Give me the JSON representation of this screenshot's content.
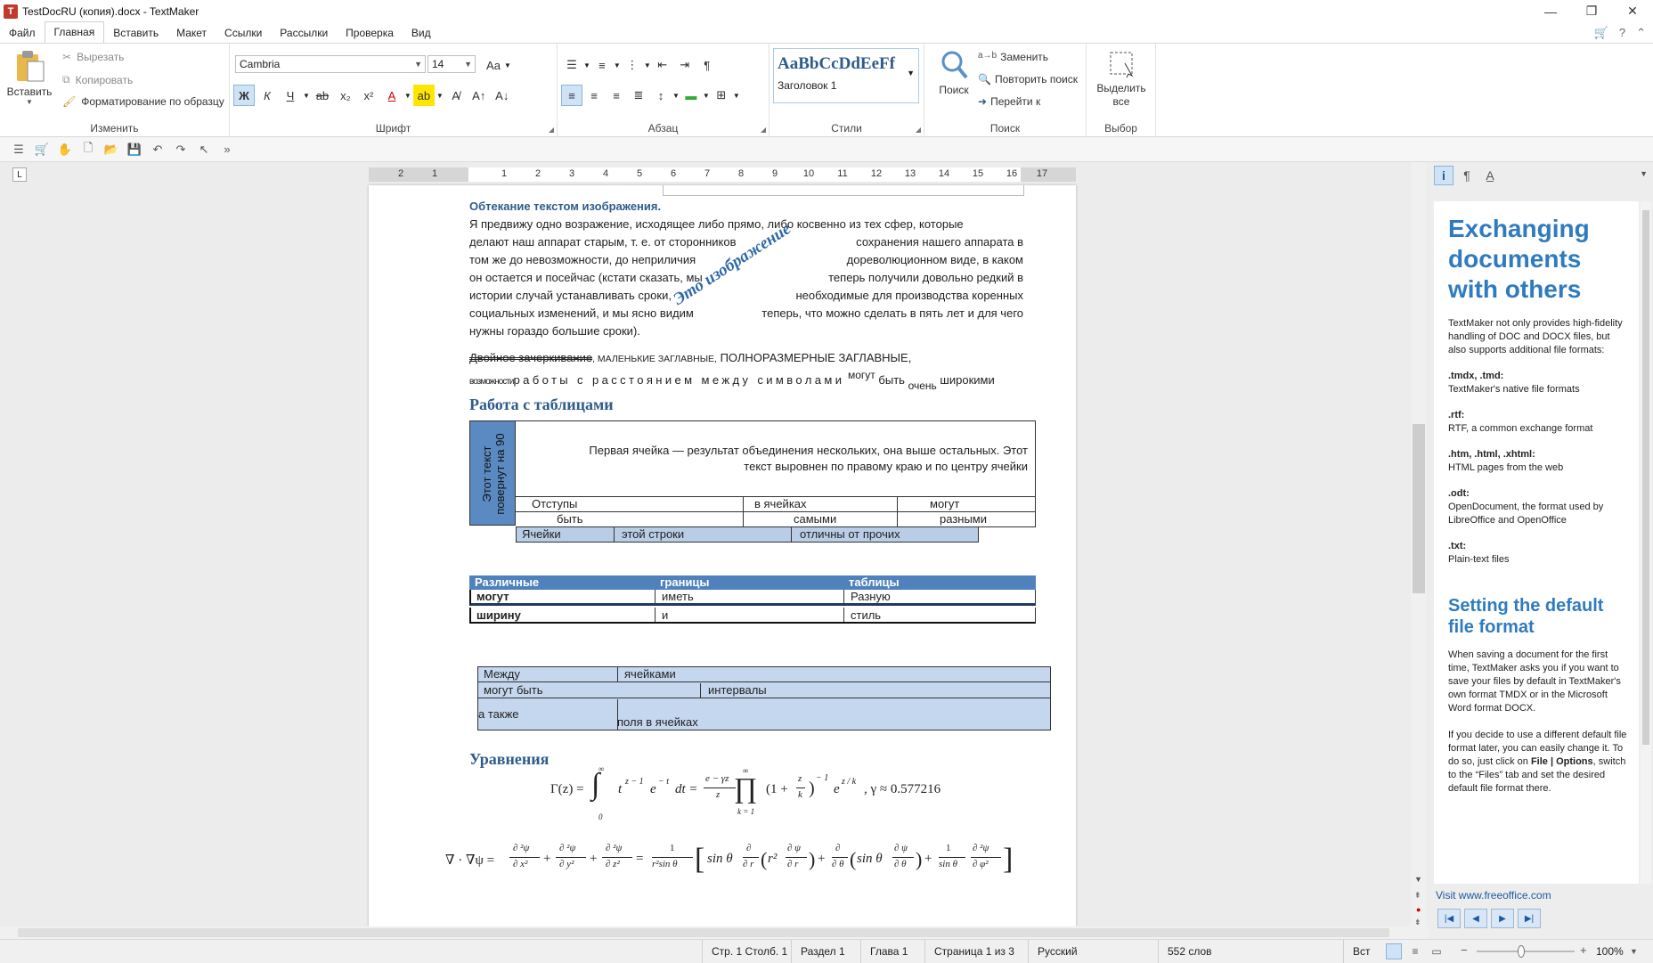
{
  "window": {
    "title": "TestDocRU (копия).docx - TextMaker"
  },
  "menu": [
    "Файл",
    "Главная",
    "Вставить",
    "Макет",
    "Ссылки",
    "Рассылки",
    "Проверка",
    "Вид"
  ],
  "ribbon": {
    "clipboard": {
      "paste": "Вставить",
      "cut": "Вырезать",
      "copy": "Копировать",
      "format_painter": "Форматирование по образцу",
      "label": "Изменить"
    },
    "font": {
      "name": "Cambria",
      "size": "14",
      "label": "Шрифт",
      "bold": "Ж",
      "italic": "К",
      "underline": "Ч"
    },
    "paragraph": {
      "label": "Абзац"
    },
    "styles": {
      "preview": "AaBbCcDdEeFf",
      "style_name": "Заголовок 1",
      "label": "Стили"
    },
    "search": {
      "find": "Поиск",
      "replace": "Заменить",
      "repeat": "Повторить поиск",
      "goto": "Перейти к",
      "label": "Поиск"
    },
    "select": {
      "select_all": "Выделить все",
      "label": "Выбор"
    }
  },
  "ruler": {
    "numbers": [
      "2",
      "1",
      "1",
      "2",
      "3",
      "4",
      "5",
      "6",
      "7",
      "8",
      "9",
      "10",
      "11",
      "12",
      "13",
      "14",
      "15",
      "16",
      "17"
    ]
  },
  "document": {
    "wrap_heading": "Обтекание текстом изображения.",
    "wrap_lines": [
      "Я предвижу одно возражение, исходящее либо прямо, либо косвенно из тех сфер, которые",
      "делают наш аппарат старым, т. е. от сторонников",
      "сохранения нашего аппарата в",
      "том же до невозможности, до неприличия",
      "дореволюционном виде, в каком",
      "он остается и посейчас (кстати сказать, мы",
      "теперь получили довольно редкий в",
      "истории случай устанавливать сроки,",
      "необходимые для производства коренных",
      "социальных изменений, и мы ясно видим",
      "теперь, что можно сделать в пять лет и для чего",
      "нужны гораздо большие сроки)."
    ],
    "rotated_image_text": "Это изображение",
    "effects": {
      "double_strike": "Двойное зачеркивание",
      "small_caps": ", МАЛЕНЬКИЕ ЗАГЛАВНЫЕ,",
      "all_caps": " ПОЛНОРАЗМЕРНЫЕ ЗАГЛАВНЫЕ,",
      "condensed": "возможности",
      "spaced": "работы с расстоянием между символами",
      "superscript": "могут",
      "normal": "быть",
      "subscript": "очень",
      "wide": "широкими"
    },
    "tables_heading": "Работа с таблицами",
    "table1": {
      "rotated": "Этот текст повернут на 90",
      "merged": "Первая ячейка — результат  объединения нескольких, она выше остальных. Этот текст выровнен по правому краю и по центру ячейки",
      "row1": [
        "Отступы",
        "в ячейках",
        "могут"
      ],
      "row2": [
        "быть",
        "самыми",
        "разными"
      ],
      "row3": [
        "Ячейки",
        "этой строки",
        "отличны от прочих"
      ]
    },
    "table2": {
      "header": [
        "Различные",
        "границы",
        "таблицы"
      ],
      "row1": [
        "могут",
        "иметь",
        "Разную"
      ],
      "row2": [
        "ширину",
        "и",
        "стиль"
      ]
    },
    "table3": {
      "row1": [
        "Между",
        "ячейками"
      ],
      "row2": [
        "могут быть",
        "интервалы"
      ],
      "row3": [
        "а также",
        "поля в ячейках"
      ]
    },
    "equations_heading": "Уравнения",
    "eq1": {
      "lhs": "Γ(z) =",
      "integrand": "t",
      "exp1": "z − 1",
      "mid": "e",
      "exp2": "− t",
      "dt": "dt =",
      "frac_num": "e − γz",
      "frac_den": "z",
      "upper": "∞",
      "lower": "0",
      "prod_upper": "∞",
      "prod_lower": "k = 1",
      "prod_body": "(1 +",
      "z": "z",
      "k": "k",
      "prod_exp": "− 1",
      "ez": "e",
      "ez_exp": "z / k",
      "gamma": ", γ ≈ 0.577216"
    },
    "eq2": {
      "lhs": "∇ · ∇ψ =",
      "t1_num": "∂ ²ψ",
      "t1_den": "∂ x²",
      "t2_num": "∂ ²ψ",
      "t2_den": "∂ y²",
      "t3_num": "∂ ²ψ",
      "t3_den": "∂ z²",
      "eq": "=",
      "c_num": "1",
      "c_den": "r²sin θ",
      "b1": "sin θ",
      "b1_num": "∂",
      "b1_den": "∂ r",
      "b2": "r² ",
      "b2_num": "∂ ψ",
      "b2_den": "∂ r",
      "b3_num": "∂",
      "b3_den": "∂ θ",
      "b4": "sin θ",
      "b4_num": "∂ ψ",
      "b4_den": "∂ θ",
      "c2_num": "1",
      "c2_den": "sin θ",
      "b5_num": "∂ ²ψ",
      "b5_den": "∂ φ²"
    }
  },
  "sidepanel": {
    "h1": "Exchanging documents with others",
    "intro": "TextMaker not only provides high-fidelity handling of DOC and DOCX files, but also supports additional file formats:",
    "formats": [
      {
        "ext": ".tmdx, .tmd:",
        "desc": "TextMaker's native file formats"
      },
      {
        "ext": ".rtf:",
        "desc": "RTF, a common exchange format"
      },
      {
        "ext": ".htm, .html, .xhtml:",
        "desc": "HTML pages from the web"
      },
      {
        "ext": ".odt:",
        "desc": "OpenDocument, the format used by LibreOffice and OpenOffice"
      },
      {
        "ext": ".txt:",
        "desc": "Plain-text files"
      }
    ],
    "h2": "Setting the default file format",
    "p1": "When saving a document for the first time, TextMaker asks you if you want to save your files by default in TextMaker's own format TMDX or in the Microsoft Word format DOCX.",
    "p2_a": "If you decide to use a different default file format later, you can easily change it. To do so, just click on ",
    "p2_b": "File | Options",
    "p2_c": ", switch to the “Files” tab and set the desired default file format there.",
    "link": "Visit www.freeoffice.com"
  },
  "status": {
    "pos": "Стр. 1 Столб. 1",
    "section": "Раздел 1",
    "chapter": "Глава 1",
    "page": "Страница 1 из 3",
    "lang": "Русский",
    "words": "552 слов",
    "mode": "Вст",
    "zoom": "100%"
  }
}
